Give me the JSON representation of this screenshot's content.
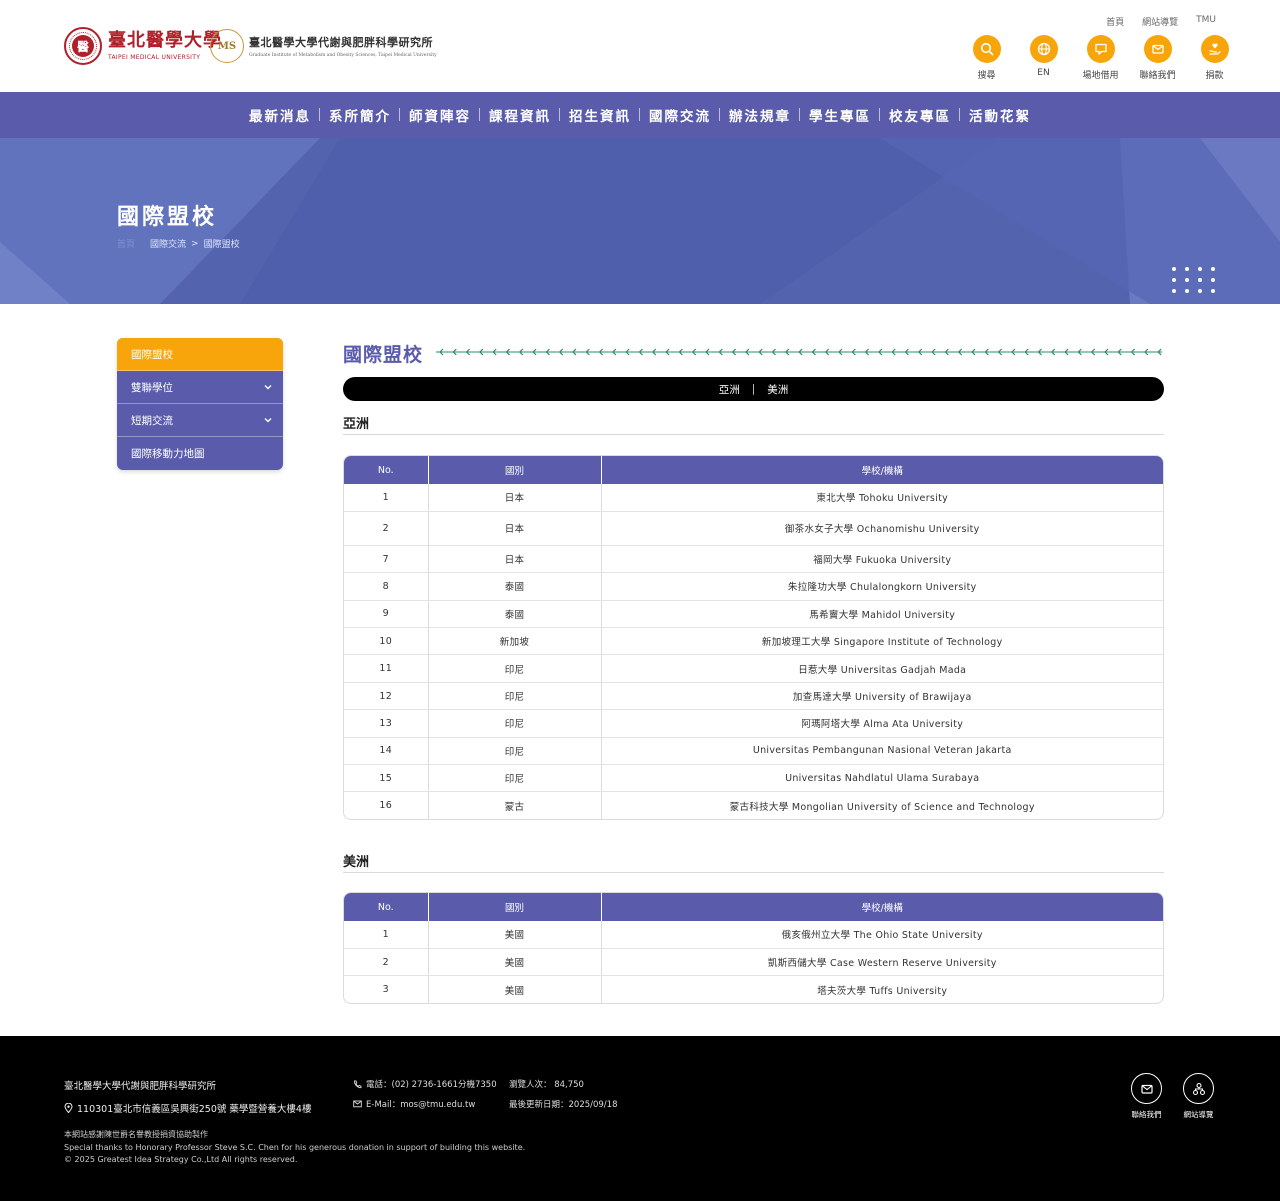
{
  "header": {
    "tmu_logo": {
      "cn": "臺北醫學大學",
      "en": "TAIPEI MEDICAL UNIVERSITY",
      "seal_char": "醫"
    },
    "institute_logo": {
      "badge": "MS",
      "cn": "臺北醫學大學代謝與肥胖科學研究所",
      "en": "Graduate Institute of Metabolism and Obesity Sciences, Taipei Medical University"
    },
    "top_links": [
      "首頁",
      "網站導覽",
      "TMU"
    ],
    "tools": [
      {
        "label": "搜尋",
        "icon": "search-icon"
      },
      {
        "label": "EN",
        "icon": "globe-icon"
      },
      {
        "label": "場地借用",
        "icon": "chat-icon"
      },
      {
        "label": "聯絡我們",
        "icon": "mail-icon"
      },
      {
        "label": "捐款",
        "icon": "donate-icon"
      }
    ]
  },
  "nav": [
    "最新消息",
    "系所簡介",
    "師資陣容",
    "課程資訊",
    "招生資訊",
    "國際交流",
    "辦法規章",
    "學生專區",
    "校友專區",
    "活動花絮"
  ],
  "banner": {
    "title": "國際盟校",
    "breadcrumb": [
      "首頁",
      "國際交流",
      "國際盟校"
    ],
    "separator": ">"
  },
  "sidebar": [
    {
      "label": "國際盟校",
      "active": true,
      "expandable": false
    },
    {
      "label": "雙聯學位",
      "active": false,
      "expandable": true
    },
    {
      "label": "短期交流",
      "active": false,
      "expandable": true
    },
    {
      "label": "國際移動力地圖",
      "active": false,
      "expandable": false
    }
  ],
  "main": {
    "title": "國際盟校",
    "tabs": [
      "亞洲",
      "美洲"
    ],
    "tab_separator": "|",
    "columns": [
      "No.",
      "國別",
      "學校/機構"
    ],
    "sections": [
      {
        "heading": "亞洲",
        "rows": [
          {
            "no": "1",
            "country": "日本",
            "school": "東北大學 Tohoku University"
          },
          {
            "no": "2",
            "country": "日本",
            "school": "御茶水女子大學 Ochanomishu University"
          },
          {
            "no": "7",
            "country": "日本",
            "school": "福岡大學 Fukuoka University"
          },
          {
            "no": "8",
            "country": "泰國",
            "school": "朱拉隆功大學 Chulalongkorn University"
          },
          {
            "no": "9",
            "country": "泰國",
            "school": "馬希竇大學 Mahidol University"
          },
          {
            "no": "10",
            "country": "新加坡",
            "school": "新加坡理工大學 Singapore Institute of Technology"
          },
          {
            "no": "11",
            "country": "印尼",
            "school": "日惹大學 Universitas Gadjah Mada"
          },
          {
            "no": "12",
            "country": "印尼",
            "school": "加查馬達大學 University of Brawijaya"
          },
          {
            "no": "13",
            "country": "印尼",
            "school": "阿瑪阿塔大學 Alma Ata University"
          },
          {
            "no": "14",
            "country": "印尼",
            "school": "Universitas Pembangunan Nasional Veteran Jakarta"
          },
          {
            "no": "15",
            "country": "印尼",
            "school": "Universitas Nahdlatul Ulama Surabaya"
          },
          {
            "no": "16",
            "country": "蒙古",
            "school": "蒙古科技大學 Mongolian University of Science and Technology"
          }
        ]
      },
      {
        "heading": "美洲",
        "rows": [
          {
            "no": "1",
            "country": "美國",
            "school": "俄亥俄州立大學 The Ohio State University"
          },
          {
            "no": "2",
            "country": "美國",
            "school": "凱斯西儲大學 Case Western Reserve University"
          },
          {
            "no": "3",
            "country": "美國",
            "school": "塔夫茨大學 Tuffs University"
          }
        ]
      }
    ]
  },
  "footer": {
    "name": "臺北醫學大學代謝與肥胖科學研究所",
    "address": "110301臺北市信義區吳興街250號 藥學暨營養大樓4樓",
    "phone": "電話：(02) 2736-1661分機7350",
    "email": "E-Mail：mos@tmu.edu.tw",
    "visitors": "瀏覽人次： 84,750",
    "updated": "最後更新日期：2025/09/18",
    "note_cn": "本網站感謝陳世爵名譽教授捐資協助製作",
    "note_en": "Special thanks to Honorary Professor Steve S.C. Chen for his generous donation in support of building this website.",
    "copyright": "© 2025 Greatest Idea Strategy Co.,Ltd All rights reserved.",
    "icons": [
      {
        "label": "聯絡我們",
        "icon": "mail-icon"
      },
      {
        "label": "網站導覽",
        "icon": "sitemap-icon"
      }
    ]
  },
  "colors": {
    "primary": "#5a5cab",
    "accent": "#f7a50a",
    "banner": "#5363ad",
    "footer": "#000000"
  }
}
